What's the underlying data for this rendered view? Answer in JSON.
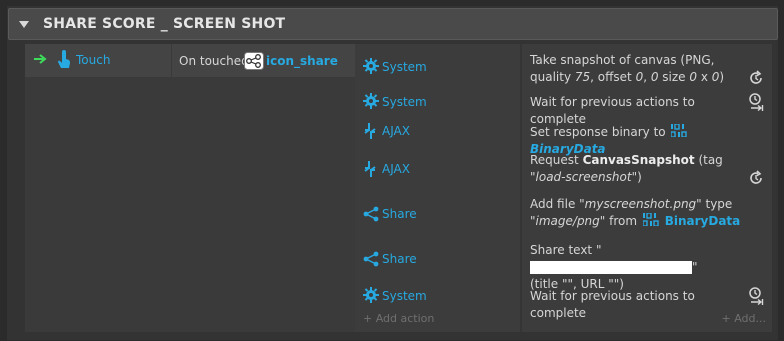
{
  "group": {
    "title": "SHARE SCORE _ SCREEN SHOT"
  },
  "condition": {
    "object_name": "Touch",
    "text": "On touched",
    "param": "icon_share"
  },
  "actions": [
    {
      "object": "System",
      "icon": "gear-icon",
      "desc_parts": {
        "p1": "Take snapshot of canvas (PNG, quality ",
        "p2": "75",
        "p3": ", offset ",
        "p4": "0",
        "p5": ", ",
        "p6": "0",
        "p7": " size ",
        "p8": "0",
        "p9": " x ",
        "p10": "0",
        "p11": ")"
      },
      "right_icon": "async-icon"
    },
    {
      "object": "System",
      "icon": "gear-icon",
      "desc": "Wait for previous actions to complete",
      "right_icon": "wait-icon"
    },
    {
      "object": "AJAX",
      "icon": "ajax-icon",
      "desc_prefix": "Set response binary to",
      "desc_param": "BinaryData"
    },
    {
      "object": "AJAX",
      "icon": "ajax-icon",
      "desc_parts": {
        "p1": "Request ",
        "p2": "CanvasSnapshot",
        "p3": " (tag \"",
        "p4": "load-screenshot",
        "p5": "\")"
      },
      "right_icon": "async-icon"
    },
    {
      "object": "Share",
      "icon": "share-icon",
      "desc_parts": {
        "p1": "Add file ",
        "p2": "\"myscreenshot.png\"",
        "p3": " type ",
        "p4": "\"image/png\"",
        "p5": " from",
        "p6": "BinaryData"
      }
    },
    {
      "object": "Share",
      "icon": "share-icon",
      "desc_parts": {
        "p1": "Share text \"",
        "p2": "\"",
        "p3": "(title \"\", URL \"\")"
      }
    },
    {
      "object": "System",
      "icon": "gear-icon",
      "desc": "Wait for previous actions to complete",
      "right_icon": "wait-icon"
    }
  ],
  "add_action_label": "+ Add action",
  "add_more_label": "+ Add..."
}
